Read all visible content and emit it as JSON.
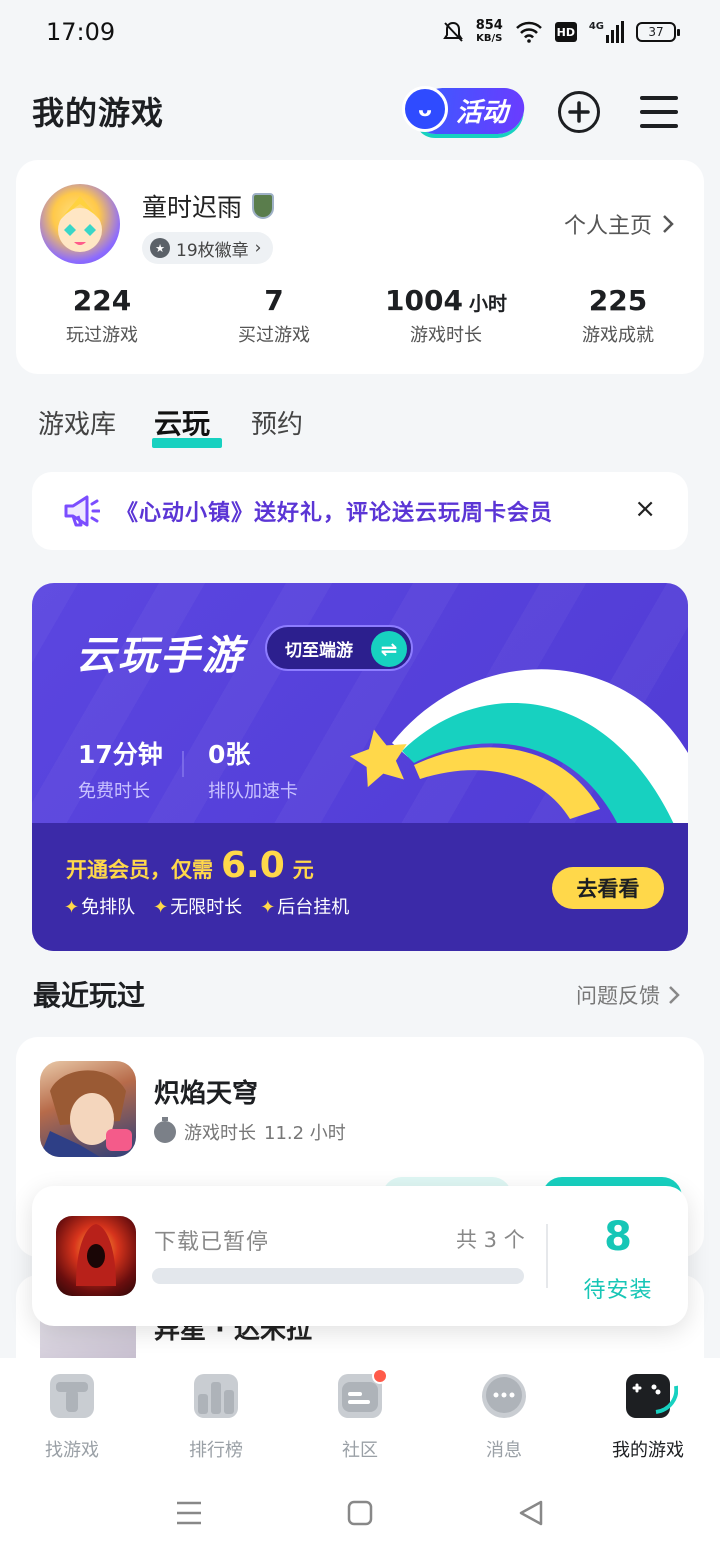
{
  "status_bar": {
    "time": "17:09",
    "net_speed_value": "854",
    "net_speed_unit": "KB/S",
    "hd_label": "HD",
    "network_label": "4G",
    "battery": "37"
  },
  "header": {
    "title": "我的游戏",
    "activity_label": "活动"
  },
  "profile": {
    "username": "童时迟雨",
    "badges_label": "19枚徽章",
    "homepage_link": "个人主页",
    "stats": [
      {
        "value": "224",
        "unit": "",
        "label": "玩过游戏"
      },
      {
        "value": "7",
        "unit": "",
        "label": "买过游戏"
      },
      {
        "value": "1004",
        "unit": "小时",
        "label": "游戏时长"
      },
      {
        "value": "225",
        "unit": "",
        "label": "游戏成就"
      }
    ]
  },
  "tabs": [
    {
      "label": "游戏库",
      "active": false
    },
    {
      "label": "云玩",
      "active": true
    },
    {
      "label": "预约",
      "active": false
    }
  ],
  "notice": {
    "text": "《心动小镇》送好礼，评论送云玩周卡会员",
    "close": "×"
  },
  "cloud_banner": {
    "title": "云玩手游",
    "switch_label": "切至端游",
    "free_time_value": "17分钟",
    "free_time_label": "免费时长",
    "queue_card_value": "0张",
    "queue_card_label": "排队加速卡",
    "vip_prefix": "开通会员，仅需",
    "vip_price": "6.0",
    "vip_unit": "元",
    "perks": [
      "免排队",
      "无限时长",
      "后台挂机"
    ],
    "cta": "去看看"
  },
  "recent": {
    "title": "最近玩过",
    "feedback": "问题反馈",
    "games": [
      {
        "name": "炽焰天穹",
        "time_label": "游戏时长",
        "time_value": "11.2 小时"
      },
      {
        "name": "异星 · 达米拉"
      }
    ]
  },
  "download": {
    "status": "下载已暂停",
    "count": "共 3 个",
    "progress": 0,
    "pending_count": "8",
    "pending_label": "待安装"
  },
  "bottom_nav": [
    {
      "label": "找游戏",
      "icon": "find-games-icon",
      "active": false
    },
    {
      "label": "排行榜",
      "icon": "ranking-icon",
      "active": false
    },
    {
      "label": "社区",
      "icon": "community-icon",
      "active": false,
      "badge": true
    },
    {
      "label": "消息",
      "icon": "message-icon",
      "active": false
    },
    {
      "label": "我的游戏",
      "icon": "my-games-icon",
      "active": true
    }
  ],
  "colors": {
    "accent": "#17d1c0",
    "banner_purple": "#5b46e0",
    "vip_yellow": "#ffd84a",
    "notice_purple": "#5b35d5"
  }
}
